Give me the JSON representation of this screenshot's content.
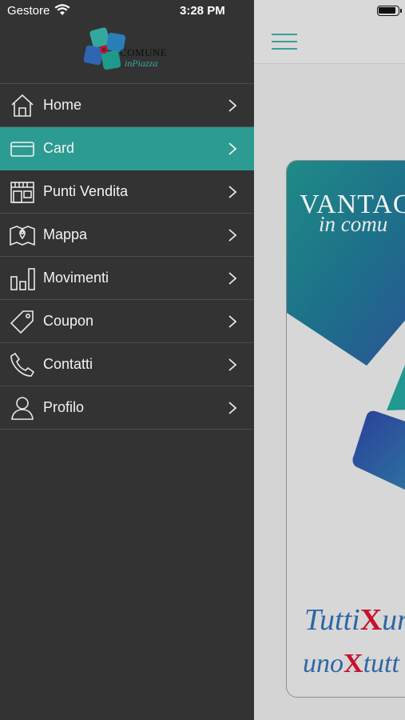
{
  "status_bar": {
    "carrier": "Gestore",
    "time": "3:28 PM"
  },
  "logo": {
    "line1": "COMUNE",
    "line2": "inPiazza"
  },
  "menu": {
    "items": [
      {
        "label": "Home",
        "icon": "home-icon",
        "active": false
      },
      {
        "label": "Card",
        "icon": "card-icon",
        "active": true
      },
      {
        "label": "Punti Vendita",
        "icon": "store-icon",
        "active": false
      },
      {
        "label": "Mappa",
        "icon": "map-icon",
        "active": false
      },
      {
        "label": "Movimenti",
        "icon": "bar-chart-icon",
        "active": false
      },
      {
        "label": "Coupon",
        "icon": "tag-icon",
        "active": false
      },
      {
        "label": "Contatti",
        "icon": "phone-icon",
        "active": false
      },
      {
        "label": "Profilo",
        "icon": "user-icon",
        "active": false
      }
    ]
  },
  "card": {
    "title": "VANTAG",
    "subtitle": "in comu",
    "slogan_line1_a": "Tutti",
    "slogan_line1_b": "un",
    "slogan_line2_a": "uno",
    "slogan_line2_b": "tutt",
    "slogan_x": "X"
  },
  "colors": {
    "accent": "#2c9b92",
    "drawer_bg": "#333333",
    "divider": "#4c4c4c",
    "slogan_blue": "#2e66a6",
    "slogan_x_red": "#c8102e"
  }
}
